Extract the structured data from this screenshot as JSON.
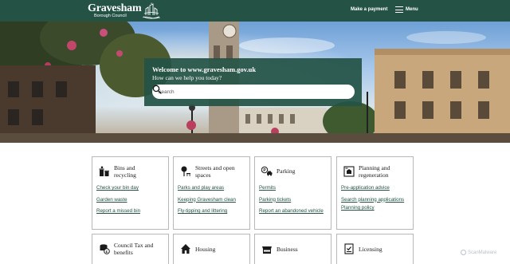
{
  "header": {
    "logo_name": "Gravesham",
    "logo_sub": "Borough Council",
    "make_payment": "Make a payment",
    "menu": "Menu"
  },
  "hero": {
    "title": "Welcome to www.gravesham.gov.uk",
    "subtitle": "How can we help you today?",
    "search_placeholder": "Search"
  },
  "cards": [
    {
      "title": "Bins and recycling",
      "icon": "bins-icon",
      "links": [
        "Check your bin day",
        "Garden waste",
        "Report a missed bin"
      ]
    },
    {
      "title": "Streets and open spaces",
      "icon": "streets-icon",
      "links": [
        "Parks and play areas",
        "Keeping Gravesham clean",
        "Fly-tipping and littering"
      ]
    },
    {
      "title": "Parking",
      "icon": "parking-icon",
      "links": [
        "Permits",
        "Parking tickets",
        "Report an abandoned vehicle"
      ]
    },
    {
      "title": "Planning and regeneration",
      "icon": "planning-icon",
      "links": [
        "Pre-application advice",
        "Search planning applications",
        "Planning policy"
      ]
    },
    {
      "title": "Council Tax and benefits",
      "icon": "council-tax-icon",
      "links": []
    },
    {
      "title": "Housing",
      "icon": "house-icon",
      "links": []
    },
    {
      "title": "Business",
      "icon": "business-icon",
      "links": []
    },
    {
      "title": "Licensing",
      "icon": "licensing-icon",
      "links": []
    }
  ],
  "watermark": "ScanMalware",
  "colors": {
    "brand": "#245346",
    "link": "#245346"
  }
}
